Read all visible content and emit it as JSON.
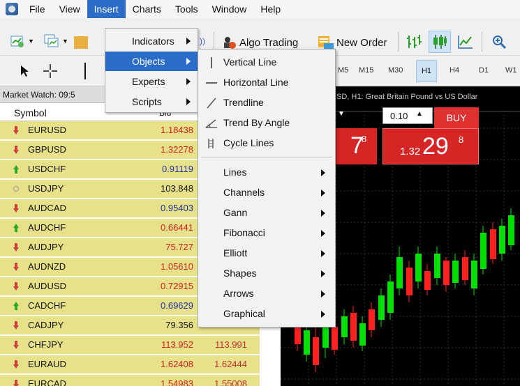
{
  "menubar": {
    "items": [
      "File",
      "View",
      "Insert",
      "Charts",
      "Tools",
      "Window",
      "Help"
    ]
  },
  "toolbar": {
    "algo_trading": "Algo Trading",
    "new_order": "New Order",
    "timeframes": [
      "M5",
      "M15",
      "M30",
      "H1",
      "H4",
      "D1",
      "W1"
    ]
  },
  "insert_menu": {
    "items": [
      "Indicators",
      "Objects",
      "Experts",
      "Scripts"
    ]
  },
  "objects_menu": {
    "items": [
      "Vertical Line",
      "Horizontal Line",
      "Trendline",
      "Trend By Angle",
      "Cycle Lines"
    ],
    "submenus": [
      "Lines",
      "Channels",
      "Gann",
      "Fibonacci",
      "Elliott",
      "Shapes",
      "Arrows",
      "Graphical"
    ]
  },
  "market_watch": {
    "title": "Market Watch: 09:5",
    "col_symbol": "Symbol",
    "col_bid": "Bid",
    "rows": [
      {
        "symbol": "EURUSD",
        "bid": "1.18438",
        "ask": "",
        "dir": "down",
        "bid_color": "red"
      },
      {
        "symbol": "GBPUSD",
        "bid": "1.32278",
        "ask": "",
        "dir": "down",
        "bid_color": "red"
      },
      {
        "symbol": "USDCHF",
        "bid": "0.91119",
        "ask": "",
        "dir": "up",
        "bid_color": "blue"
      },
      {
        "symbol": "USDJPY",
        "bid": "103.848",
        "ask": "",
        "dir": "flat",
        "bid_color": "black"
      },
      {
        "symbol": "AUDCAD",
        "bid": "0.95403",
        "ask": "",
        "dir": "down",
        "bid_color": "blue"
      },
      {
        "symbol": "AUDCHF",
        "bid": "0.66441",
        "ask": "",
        "dir": "up",
        "bid_color": "red"
      },
      {
        "symbol": "AUDJPY",
        "bid": "75.727",
        "ask": "",
        "dir": "down",
        "bid_color": "red"
      },
      {
        "symbol": "AUDNZD",
        "bid": "1.05610",
        "ask": "",
        "dir": "down",
        "bid_color": "red"
      },
      {
        "symbol": "AUDUSD",
        "bid": "0.72915",
        "ask": "",
        "dir": "down",
        "bid_color": "red"
      },
      {
        "symbol": "CADCHF",
        "bid": "0.69629",
        "ask": "",
        "dir": "up",
        "bid_color": "blue"
      },
      {
        "symbol": "CADJPY",
        "bid": "79.356",
        "ask": "",
        "dir": "down",
        "bid_color": "black"
      },
      {
        "symbol": "CHFJPY",
        "bid": "113.952",
        "ask": "113.991",
        "dir": "down",
        "bid_color": "red"
      },
      {
        "symbol": "EURAUD",
        "bid": "1.62408",
        "ask": "1.62444",
        "dir": "down",
        "bid_color": "red"
      },
      {
        "symbol": "EURCAD",
        "bid": "1.54983",
        "ask": "1.55008",
        "dir": "down",
        "bid_color": "red"
      }
    ]
  },
  "chart": {
    "title": "SD, H1: Great Britain Pound vs US Dollar",
    "lot": "0.10",
    "buy_label": "BUY",
    "sell_big": "7",
    "sell_sup": "8",
    "buy_small": "1.32",
    "buy_big": "29",
    "buy_sup": "8"
  },
  "colors": {
    "accent": "#2b6cc8",
    "row_bg": "#e7e28a",
    "bull": "#00e000",
    "bear": "#ff2020"
  }
}
